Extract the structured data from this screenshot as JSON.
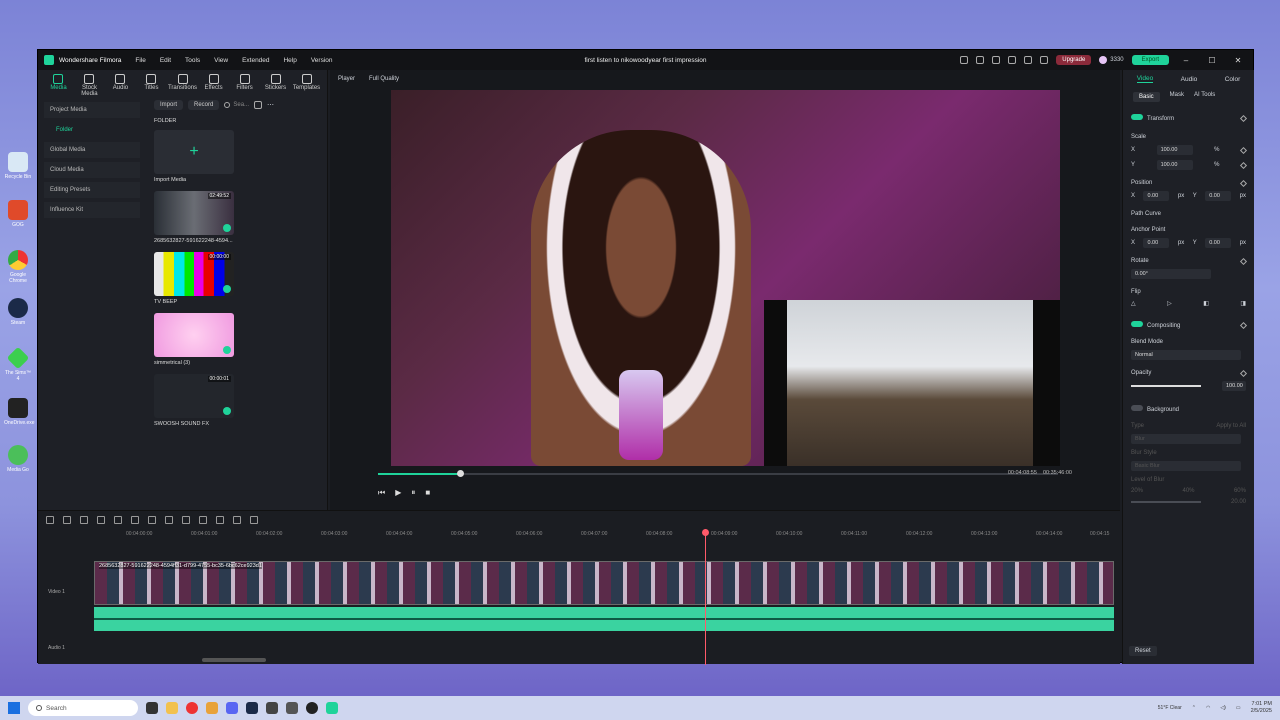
{
  "desktop": {
    "icons": [
      "Recycle Bin",
      "GOG",
      "Google Chrome",
      "Steam",
      "The Sims™ 4",
      "OneDrive.exe",
      "Media Go"
    ]
  },
  "window": {
    "app_name": "Wondershare Filmora",
    "menu": [
      "File",
      "Edit",
      "Tools",
      "View",
      "Extended",
      "Help",
      "Version"
    ],
    "title": "first listen to nikowoodyear first impression",
    "upgrade_label": "Upgrade",
    "credits": "3330",
    "export_label": "Export"
  },
  "toolbar": {
    "items": [
      "Media",
      "Stock Media",
      "Audio",
      "Titles",
      "Transitions",
      "Effects",
      "Filters",
      "Stickers",
      "Templates"
    ]
  },
  "left_nav": {
    "items": [
      "Project Media",
      "Folder",
      "Global Media",
      "Cloud Media",
      "Editing Presets",
      "Influence Kit"
    ]
  },
  "media": {
    "import_label": "Import",
    "record_label": "Record",
    "search_placeholder": "Sea...",
    "folder_label": "FOLDER",
    "import_media_label": "Import Media",
    "items": [
      {
        "name": "2685632827-591622248-4594...",
        "duration": "02:49:52"
      },
      {
        "name": "TV BEEP",
        "duration": "00:00:00"
      },
      {
        "name": "simmetrical (3)",
        "duration": ""
      },
      {
        "name": "SWOOSH SOUND FX",
        "duration": "00:00:01"
      }
    ]
  },
  "player": {
    "label": "Player",
    "quality": "Full Quality",
    "current_time": "00:04:08:55",
    "total_time": "00:35:46:00",
    "progress": 0.12
  },
  "inspector": {
    "tabs": [
      "Video",
      "Audio",
      "Color"
    ],
    "subtabs": [
      "Basic",
      "Mask",
      "AI Tools"
    ],
    "transform": "Transform",
    "scale_label": "Scale",
    "scale_x": "100.00",
    "scale_y": "100.00",
    "percent": "%",
    "x_label": "X",
    "y_label": "Y",
    "position_label": "Position",
    "pos_x": "0.00",
    "pos_y": "0.00",
    "px_unit": "px",
    "path_curve": "Path Curve",
    "anchor_label": "Anchor Point",
    "anchor_x": "0.00",
    "anchor_y": "0.00",
    "rotate_label": "Rotate",
    "rotate_value": "0.00°",
    "flip_label": "Flip",
    "compositing": "Compositing",
    "blend_label": "Blend Mode",
    "blend_value": "Normal",
    "opacity_label": "Opacity",
    "opacity_value": "100.00",
    "background": "Background",
    "type_label": "Type",
    "apply_all": "Apply to All",
    "type_value": "Blur",
    "blur_style_label": "Blur Style",
    "blur_style_value": "Basic Blur",
    "level_label": "Level of Blur",
    "blur_levels": [
      "20%",
      "40%",
      "60%"
    ],
    "blur_value": "20.00",
    "reset_label": "Reset"
  },
  "timeline": {
    "ruler": [
      "00:04:00:00",
      "00:04:01:00",
      "00:04:02:00",
      "00:04:03:00",
      "00:04:04:00",
      "00:04:05:00",
      "00:04:06:00",
      "00:04:07:00",
      "00:04:08:00",
      "00:04:09:00",
      "00:04:10:00",
      "00:04:11:00",
      "00:04:12:00",
      "00:04:13:00",
      "00:04:14:00",
      "00:04:15"
    ],
    "clip_label": "2685632827-591622248-4594ff31-d799-4755-bc35-6bc62ce923d1",
    "video_track": "Video 1",
    "audio_track": "Audio 1"
  },
  "taskbar": {
    "search_placeholder": "Search",
    "weather_temp": "51°F",
    "weather_cond": "Clear",
    "time": "7:01 PM",
    "date": "2/5/2025"
  }
}
